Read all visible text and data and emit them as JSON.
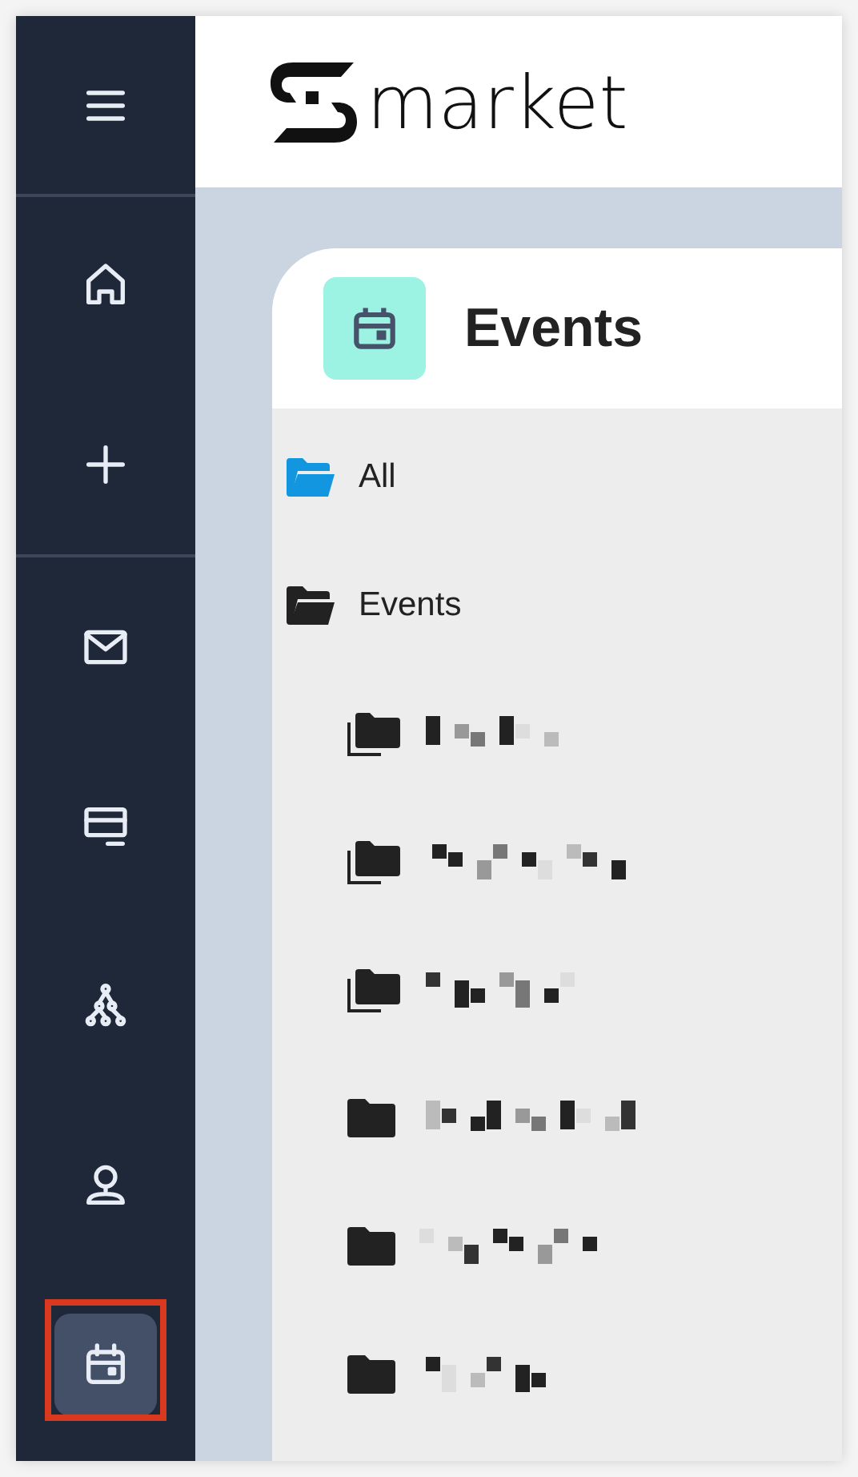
{
  "sidebar": {
    "items": [
      {
        "kind": "menu",
        "selected": false,
        "highlighted": false
      },
      {
        "kind": "home",
        "selected": false,
        "highlighted": false
      },
      {
        "kind": "add",
        "selected": false,
        "highlighted": false
      },
      {
        "kind": "divider"
      },
      {
        "kind": "mail",
        "selected": false,
        "highlighted": false
      },
      {
        "kind": "monitor",
        "selected": false,
        "highlighted": false
      },
      {
        "kind": "network",
        "selected": false,
        "highlighted": false
      },
      {
        "kind": "user",
        "selected": false,
        "highlighted": false
      },
      {
        "kind": "calendar",
        "selected": true,
        "highlighted": true
      }
    ]
  },
  "header": {
    "logo_text": "market"
  },
  "panel": {
    "title": "Events",
    "tree": [
      {
        "label": "All",
        "kind": "open_folder",
        "color": "#1296e0"
      },
      {
        "label": "Events",
        "kind": "open_folder",
        "color": "#222222",
        "children": [
          {
            "kind": "folder_stack"
          },
          {
            "kind": "folder_stack"
          },
          {
            "kind": "folder_stack"
          },
          {
            "kind": "folder"
          },
          {
            "kind": "folder"
          },
          {
            "kind": "folder"
          }
        ]
      }
    ]
  }
}
